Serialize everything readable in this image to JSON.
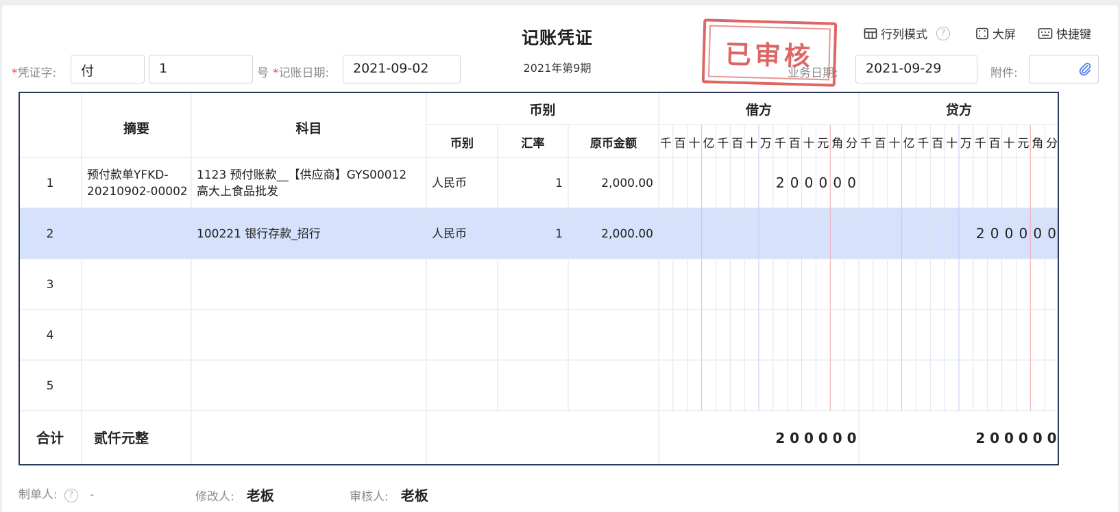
{
  "header": {
    "title": "记账凭证",
    "period": "2021年第9期",
    "voucher_word_label": "凭证字:",
    "voucher_word": "付",
    "voucher_number": "1",
    "number_suffix": "号",
    "date_label": "记账日期:",
    "date_value": "2021-09-02",
    "business_date_label": "业务日期:",
    "business_date_value": "2021-09-29",
    "attachment_label": "附件:",
    "attachment_value": "",
    "stamp_text": "已审核"
  },
  "toolbar": {
    "row_col_mode": "行列模式",
    "fullscreen": "大屏",
    "shortcuts": "快捷键"
  },
  "table": {
    "headers": {
      "summary": "摘要",
      "account": "科目",
      "currency_group": "币别",
      "currency": "币别",
      "rate": "汇率",
      "orig_amount": "原币金额",
      "debit": "借方",
      "credit": "贷方"
    },
    "digit_units": [
      "千",
      "百",
      "十",
      "亿",
      "千",
      "百",
      "十",
      "万",
      "千",
      "百",
      "十",
      "元",
      "角",
      "分"
    ],
    "rows": [
      {
        "no": "1",
        "summary": [
          "预付款单YFKD-",
          "20210902-00002"
        ],
        "account": [
          "1123 预付账款__【供应商】GYS00012",
          "高大上食品批发"
        ],
        "currency": "人民币",
        "rate": "1",
        "amount": "2,000.00",
        "debit": "200000",
        "credit": "",
        "highlight": false
      },
      {
        "no": "2",
        "summary": [],
        "account": [
          "100221 银行存款_招行"
        ],
        "currency": "人民币",
        "rate": "1",
        "amount": "2,000.00",
        "debit": "",
        "credit": "200000",
        "highlight": true
      },
      {
        "no": "3",
        "summary": [],
        "account": [],
        "currency": "",
        "rate": "",
        "amount": "",
        "debit": "",
        "credit": "",
        "highlight": false
      },
      {
        "no": "4",
        "summary": [],
        "account": [],
        "currency": "",
        "rate": "",
        "amount": "",
        "debit": "",
        "credit": "",
        "highlight": false
      },
      {
        "no": "5",
        "summary": [],
        "account": [],
        "currency": "",
        "rate": "",
        "amount": "",
        "debit": "",
        "credit": "",
        "highlight": false
      }
    ],
    "total_label": "合计",
    "total_words": "贰仟元整",
    "total_debit": "200000",
    "total_credit": "200000"
  },
  "footer": {
    "creator_label": "制单人:",
    "creator_value": "-",
    "modifier_label": "修改人:",
    "modifier_value": "老板",
    "auditor_label": "审核人:",
    "auditor_value": "老板"
  },
  "colors": {
    "border_dark": "#2b3a5c",
    "grid_line": "#dfe3ee",
    "highlight_row": "#d6e2fb",
    "unit_separator": "#b9cdf2",
    "yuan_separator": "#f2a9a9",
    "stamp_red": "#d43c3c",
    "required": "#e5484d"
  }
}
